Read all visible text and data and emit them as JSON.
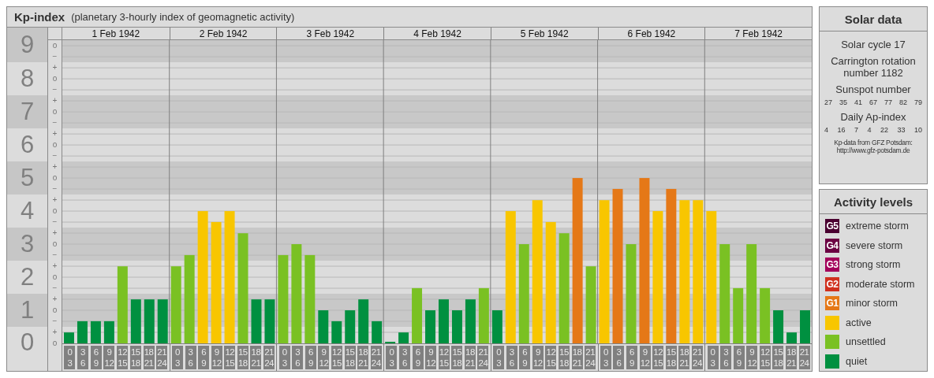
{
  "kp_chart": {
    "title": "Kp-index",
    "subtitle": "(planetary 3-hourly index of geomagnetic activity)",
    "minor_ticks": [
      [
        "o",
        "−"
      ],
      [
        "+",
        "o",
        "−"
      ],
      [
        "+",
        "o",
        "−"
      ],
      [
        "+",
        "o",
        "−"
      ],
      [
        "+",
        "o",
        "−"
      ],
      [
        "+",
        "o",
        "−"
      ],
      [
        "+",
        "o",
        "−"
      ],
      [
        "+",
        "o",
        "−"
      ],
      [
        "+",
        "o",
        "−"
      ],
      [
        "+",
        "o"
      ]
    ],
    "days": [
      {
        "date": "1 Feb 1942",
        "slots": [
          {
            "start": "0",
            "end": "3"
          },
          {
            "start": "3",
            "end": "6"
          },
          {
            "start": "6",
            "end": "9"
          },
          {
            "start": "9",
            "end": "12"
          },
          {
            "start": "12",
            "end": "15"
          },
          {
            "start": "15",
            "end": "18"
          },
          {
            "start": "18",
            "end": "21"
          },
          {
            "start": "21",
            "end": "24"
          }
        ]
      },
      {
        "date": "2 Feb 1942",
        "slots": [
          {
            "start": "0",
            "end": "3"
          },
          {
            "start": "3",
            "end": "6"
          },
          {
            "start": "6",
            "end": "9"
          },
          {
            "start": "9",
            "end": "12"
          },
          {
            "start": "12",
            "end": "15"
          },
          {
            "start": "15",
            "end": "18"
          },
          {
            "start": "18",
            "end": "21"
          },
          {
            "start": "21",
            "end": "24"
          }
        ]
      },
      {
        "date": "3 Feb 1942",
        "slots": [
          {
            "start": "0",
            "end": "3"
          },
          {
            "start": "3",
            "end": "6"
          },
          {
            "start": "6",
            "end": "9"
          },
          {
            "start": "9",
            "end": "12"
          },
          {
            "start": "12",
            "end": "15"
          },
          {
            "start": "15",
            "end": "18"
          },
          {
            "start": "18",
            "end": "21"
          },
          {
            "start": "21",
            "end": "24"
          }
        ]
      },
      {
        "date": "4 Feb 1942",
        "slots": [
          {
            "start": "0",
            "end": "3"
          },
          {
            "start": "3",
            "end": "6"
          },
          {
            "start": "6",
            "end": "9"
          },
          {
            "start": "9",
            "end": "12"
          },
          {
            "start": "12",
            "end": "15"
          },
          {
            "start": "15",
            "end": "18"
          },
          {
            "start": "18",
            "end": "21"
          },
          {
            "start": "21",
            "end": "24"
          }
        ]
      },
      {
        "date": "5 Feb 1942",
        "slots": [
          {
            "start": "0",
            "end": "3"
          },
          {
            "start": "3",
            "end": "6"
          },
          {
            "start": "6",
            "end": "9"
          },
          {
            "start": "9",
            "end": "12"
          },
          {
            "start": "12",
            "end": "15"
          },
          {
            "start": "15",
            "end": "18"
          },
          {
            "start": "18",
            "end": "21"
          },
          {
            "start": "21",
            "end": "24"
          }
        ]
      },
      {
        "date": "6 Feb 1942",
        "slots": [
          {
            "start": "0",
            "end": "3"
          },
          {
            "start": "3",
            "end": "6"
          },
          {
            "start": "6",
            "end": "9"
          },
          {
            "start": "9",
            "end": "12"
          },
          {
            "start": "12",
            "end": "15"
          },
          {
            "start": "15",
            "end": "18"
          },
          {
            "start": "18",
            "end": "21"
          },
          {
            "start": "21",
            "end": "24"
          }
        ]
      },
      {
        "date": "7 Feb 1942",
        "slots": [
          {
            "start": "0",
            "end": "3"
          },
          {
            "start": "3",
            "end": "6"
          },
          {
            "start": "6",
            "end": "9"
          },
          {
            "start": "9",
            "end": "12"
          },
          {
            "start": "12",
            "end": "15"
          },
          {
            "start": "15",
            "end": "18"
          },
          {
            "start": "18",
            "end": "21"
          },
          {
            "start": "21",
            "end": "24"
          }
        ]
      }
    ],
    "chart_data": {
      "type": "bar",
      "grid": true,
      "ylim": [
        0,
        9.17
      ],
      "yticks": [
        0,
        1,
        2,
        3,
        4,
        5,
        6,
        7,
        8,
        9
      ],
      "values": [
        0.33,
        0.67,
        0.67,
        0.67,
        2.33,
        1.33,
        1.33,
        1.33,
        2.33,
        2.67,
        4,
        3.67,
        4,
        3.33,
        1.33,
        1.33,
        2.67,
        3,
        2.67,
        1,
        0.67,
        1,
        1.33,
        0.67,
        0,
        0.33,
        1.67,
        1,
        1.33,
        1,
        1.33,
        1.67,
        1,
        4,
        3,
        4.33,
        3.67,
        3.33,
        5,
        2.33,
        4.33,
        4.67,
        3,
        5,
        4,
        4.67,
        4.33,
        4.33,
        4,
        3,
        1.67,
        3,
        1.67,
        1,
        0.33,
        1
      ]
    }
  },
  "solar_data": {
    "title": "Solar data",
    "cycle": "Solar cycle 17",
    "rotation": "Carrington rotation number 1182",
    "sunspot_label": "Sunspot number",
    "sunspot_numbers": [
      "27",
      "35",
      "41",
      "67",
      "77",
      "82",
      "79"
    ],
    "ap_label": "Daily Ap-index",
    "ap_values": [
      "4",
      "16",
      "7",
      "4",
      "22",
      "33",
      "10"
    ],
    "source": "Kp-data from GFZ Potsdam:",
    "source_url": "http://www.gfz-potsdam.de"
  },
  "activity_levels": {
    "title": "Activity levels",
    "items": [
      {
        "badge": "G5",
        "label": "extreme storm",
        "color": "#4a0030"
      },
      {
        "badge": "G4",
        "label": "severe storm",
        "color": "#6b0042"
      },
      {
        "badge": "G3",
        "label": "strong storm",
        "color": "#a3005a"
      },
      {
        "badge": "G2",
        "label": "moderate storm",
        "color": "#d0301e"
      },
      {
        "badge": "G1",
        "label": "minor storm",
        "color": "#e57817"
      },
      {
        "label": "active",
        "color": "#f8c600"
      },
      {
        "label": "unsettled",
        "color": "#7ac123"
      },
      {
        "label": "quiet",
        "color": "#009040"
      }
    ]
  }
}
